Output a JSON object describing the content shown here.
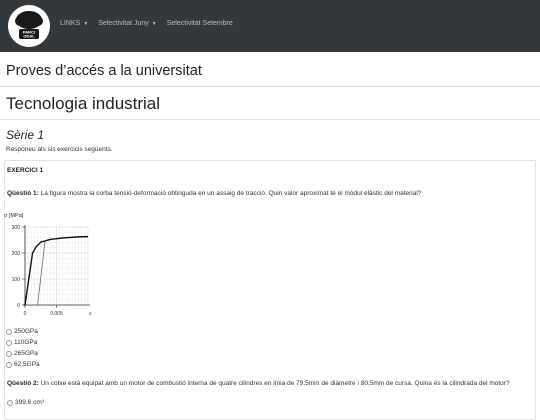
{
  "nav": {
    "logo_text": "PARCI ODAL",
    "links": [
      {
        "label": "LINKS",
        "has_caret": true
      },
      {
        "label": "Selectivitat Juny",
        "has_caret": true
      },
      {
        "label": "Selectivitat Setembre",
        "has_caret": false
      }
    ]
  },
  "headings": {
    "page_title": "Proves d’accés a la universitat",
    "subject": "Tecnologia industrial",
    "series": "Sèrie 1",
    "instructions": "Responeu als sis exercicis següents."
  },
  "exercise": {
    "title": "EXERCICI 1",
    "q1_label": "Qüestió 1:",
    "q1_text": " La figura mostra la corba tensió-deformació obtinguda en un assaig de tracció. Quin valor aproximat té el mòdul elàstic del material?",
    "q1_options": [
      "250GPa",
      "110GPa",
      "265GPa",
      "62,5GPa"
    ],
    "q2_label": "Qüestió 2:",
    "q2_text": " Un cotxe està equipat amb un motor de combustió interna de quatre cilindres en línia de 79,5mm de diàmetre i 80,5mm de cursa. Quina és la cilindrada del motor?",
    "q2_first_option_partial": "399,6 cm³"
  },
  "chart_data": {
    "type": "line",
    "ylabel": "σ [MPa]",
    "xlabel": "ε",
    "y_ticks": [
      "0",
      "100",
      "200",
      "300"
    ],
    "x_ticks": [
      "0",
      "0,005",
      "ε"
    ],
    "ylim": [
      0,
      300
    ],
    "xlim": [
      0,
      0.01
    ],
    "grid": true,
    "series": [
      {
        "points": [
          [
            0,
            0
          ],
          [
            0.0012,
            200
          ],
          [
            0.0018,
            225
          ],
          [
            0.0025,
            242
          ],
          [
            0.004,
            252
          ],
          [
            0.006,
            258
          ],
          [
            0.0085,
            262
          ],
          [
            0.01,
            263
          ]
        ]
      },
      {
        "points": [
          [
            0.002,
            0
          ],
          [
            0.0032,
            250
          ]
        ],
        "style": "offset-line"
      }
    ]
  }
}
